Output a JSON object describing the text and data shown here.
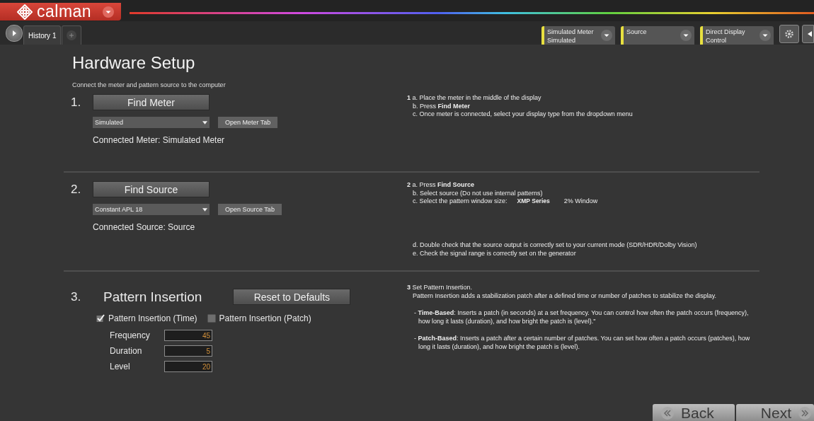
{
  "app": {
    "logo": "calman"
  },
  "tabs": [
    {
      "label": "History 1",
      "selected": true
    }
  ],
  "devices": [
    {
      "label": "Simulated Meter",
      "sublabel": "Simulated"
    },
    {
      "label": "Source"
    },
    {
      "label": "Direct Display Control"
    }
  ],
  "page": {
    "title": "Hardware Setup",
    "subtitle": "Connect the meter and pattern source to the computer"
  },
  "steps": [
    {
      "number": "1.",
      "button": "Find Meter",
      "dropdown": "Simulated",
      "open_button": "Open Meter Tab",
      "status": "Connected Meter: Simulated Meter",
      "instructions": [
        [
          {
            "kind": "text",
            "text": "**1** a. Place the meter in the middle of the display"
          },
          {
            "kind": "sub",
            "text": "b. Press **Find Meter**"
          },
          {
            "kind": "sub",
            "text": "c. Once meter is connected, select your display type from the dropdown menu"
          }
        ]
      ]
    },
    {
      "number": "2.",
      "button": "Find Source",
      "dropdown": "Constant APL 18",
      "open_button": "Open Source Tab",
      "status": "Connected Source: Source",
      "instructions": [
        [
          {
            "kind": "text",
            "text": "**2** a. Press **Find Source**"
          },
          {
            "kind": "sub",
            "text": "b. Select source (Do not use internal patterns)"
          },
          {
            "kind": "choice",
            "text": "c. Select the pattern window size:",
            "series": "XMP Series",
            "window": "2% Window"
          }
        ],
        [
          {
            "kind": "sub",
            "text": "d. Double check that the source output is correctly set to your current mode (SDR/HDR/Dolby Vision)"
          },
          {
            "kind": "sub",
            "text": "e. Check the signal range is correctly set on the generator"
          }
        ]
      ]
    }
  ],
  "pattern": {
    "number": "3.",
    "title": "Pattern Insertion",
    "reset": "Reset to Defaults",
    "options": [
      {
        "label": "Pattern Insertion (Time)",
        "checked": true
      },
      {
        "label": "Pattern Insertion (Patch)",
        "checked": false
      }
    ],
    "fields": [
      {
        "label": "Frequency",
        "value": "45"
      },
      {
        "label": "Duration",
        "value": "5"
      },
      {
        "label": "Level",
        "value": "20"
      }
    ],
    "instructions": [
      [
        {
          "kind": "text",
          "text": "**3** Set Pattern Insertion."
        },
        {
          "kind": "sub",
          "text": "Pattern Insertion adds a stabilization patch after a defined time or number of patches to stabilize the display."
        }
      ],
      [
        {
          "kind": "bullet",
          "text": "- **Time-Based**: Inserts a patch (in seconds) at a set frequency. You can control how often the patch occurs (frequency), how long it lasts (duration), and how bright the patch is (level).\""
        }
      ],
      [
        {
          "kind": "bullet",
          "text": "- **Patch-Based**: Inserts a patch after a certain number of patches. You can set how often a patch occurs (patches), how long it lasts (duration), and how bright the patch is (level)."
        }
      ]
    ]
  },
  "nav": [
    {
      "label": "Back",
      "kind": "back"
    },
    {
      "label": "Next",
      "kind": "next"
    }
  ]
}
